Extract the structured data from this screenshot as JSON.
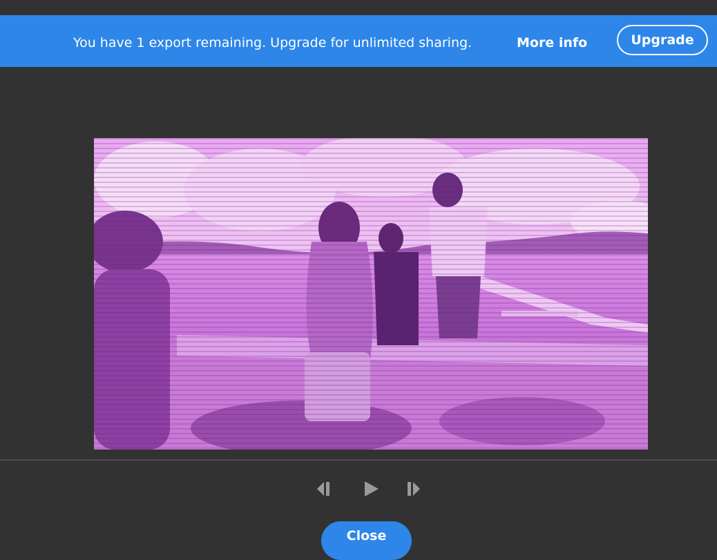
{
  "banner": {
    "message": "You have 1 export remaining. Upgrade for unlimited sharing.",
    "more_info_label": "More info",
    "upgrade_label": "Upgrade",
    "color": "#2d86e8"
  },
  "preview": {
    "tint_color": "#d98ce8"
  },
  "playback": {
    "prev_frame_icon": "step-backward-icon",
    "play_icon": "play-icon",
    "next_frame_icon": "step-forward-icon"
  },
  "footer": {
    "close_label": "Close"
  }
}
